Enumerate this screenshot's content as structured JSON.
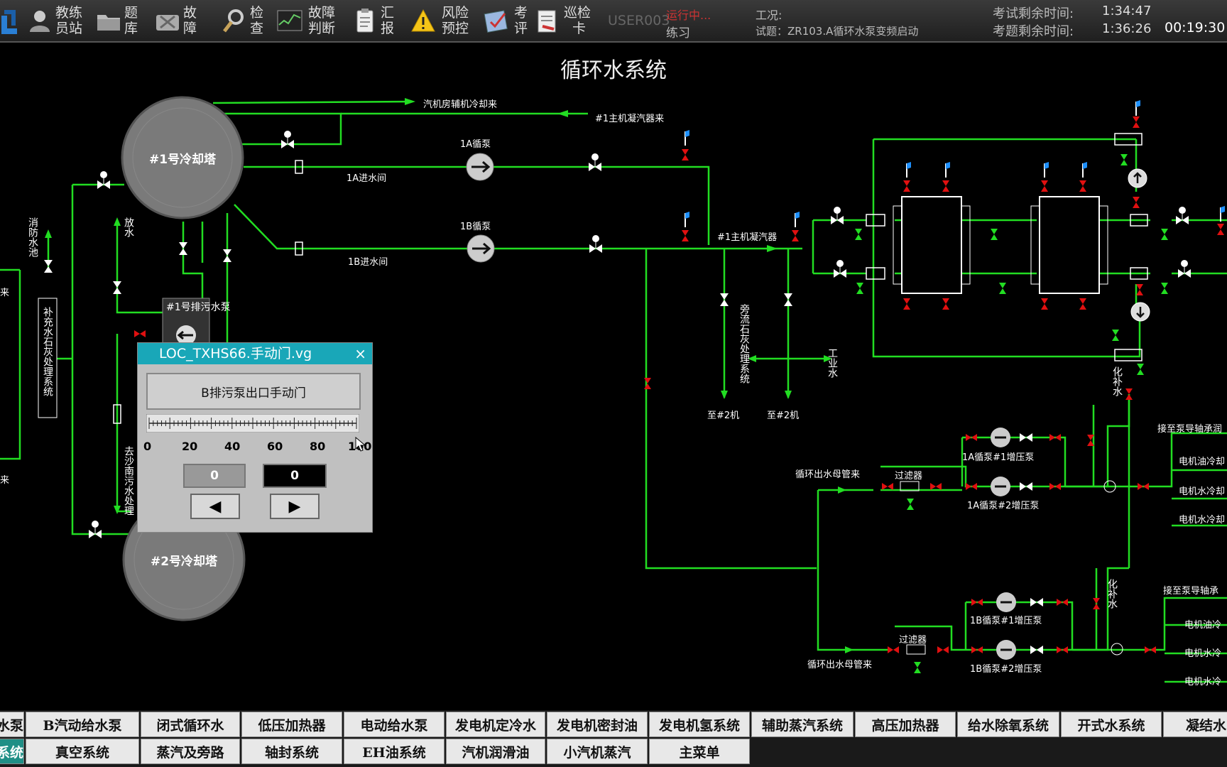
{
  "toolbar": {
    "items": [
      {
        "label_top": "教练",
        "label_bottom": "员站",
        "icon": "user-icon"
      },
      {
        "label_top": "题",
        "label_bottom": "库",
        "icon": "folder-icon"
      },
      {
        "label_top": "故",
        "label_bottom": "障",
        "icon": "tools-icon"
      },
      {
        "label_top": "检",
        "label_bottom": "查",
        "icon": "magnifier-icon"
      },
      {
        "label_top": "故障",
        "label_bottom": "判断",
        "icon": "trend-icon"
      },
      {
        "label_top": "汇",
        "label_bottom": "报",
        "icon": "clipboard-icon"
      },
      {
        "label_top": "风险",
        "label_bottom": "预控",
        "icon": "warning-icon"
      },
      {
        "label_top": "考",
        "label_bottom": "评",
        "icon": "evaluate-icon"
      },
      {
        "label_top": "巡检",
        "label_bottom": "卡",
        "icon": "inspection-card-icon"
      }
    ],
    "user": "USER003",
    "running": "运行中...",
    "mode": "练习",
    "condition_label": "工况:",
    "exam_question": "试题：ZR103.A循环水泵变频启动",
    "exam_remaining_label": "考试剩余时间:",
    "exam_remaining": "1:34:47",
    "question_remaining_label": "考题剩余时间:",
    "question_remaining": "1:36:26",
    "clock": "00:19:30"
  },
  "title": "循环水系统",
  "diagram": {
    "tower1": "#1号冷却塔",
    "tower2": "#2号冷却塔",
    "from_aux_cooling": "汽机房辅机冷却来",
    "from_main_condenser": "#1主机凝汽器来",
    "pump_1a": "1A循泵",
    "pump_1b": "1B循泵",
    "inlet_1a": "1A进水间",
    "inlet_1b": "1B进水间",
    "condenser": "#1主机凝汽器",
    "to_unit2_a": "至#2机",
    "to_unit2_b": "至#2机",
    "bypass_lime": "旁流石灰处理系统",
    "industrial_water": "工业水",
    "fire_pool": "消防水池",
    "makeup_lime": "补充水石灰处理系统",
    "drain": "放水",
    "drain_pump": "#1号排污水泵",
    "to_shanan": "去沙南污水处理",
    "left_cut_1": "来",
    "left_cut_2": "来",
    "circ_outlet_1": "循环出水母管来",
    "circ_outlet_2": "循环出水母管来",
    "filter_1": "过滤器",
    "filter_2": "过滤器",
    "booster_1a1": "1A循泵#1增压泵",
    "booster_1a2": "1A循泵#2增压泵",
    "booster_1b1": "1B循泵#1增压泵",
    "booster_1b2": "1B循泵#2增压泵",
    "chem_makeup_1": "化补水",
    "chem_makeup_2": "化补水",
    "to_bearing_1": "接至泵导轴承润",
    "to_bearing_2": "接至泵导轴承",
    "motor_oil_1": "电机油冷却",
    "motor_water_1": "电机水冷却",
    "motor_water_2": "电机水冷却",
    "motor_oil_2": "电机油冷",
    "motor_water_3": "电机水冷",
    "motor_water_4": "电机水冷"
  },
  "dialog": {
    "title": "LOC_TXHS66.手动门.vg",
    "close": "×",
    "name": "B排污泵出口手动门",
    "scale": [
      "0",
      "20",
      "40",
      "60",
      "80",
      "100"
    ],
    "value_set": "0",
    "value_actual": "0",
    "left_button": "◀",
    "right_button": "▶"
  },
  "bottom_nav": {
    "row1": [
      "水泵",
      "B汽动给水泵",
      "闭式循环水",
      "低压加热器",
      "电动给水泵",
      "发电机定冷水",
      "发电机密封油",
      "发电机氢系统",
      "辅助蒸汽系统",
      "高压加热器",
      "给水除氧系统",
      "开式水系统",
      "凝结水系"
    ],
    "row2": [
      "系统",
      "真空系统",
      "蒸汽及旁路",
      "轴封系统",
      "EH油系统",
      "汽机润滑油",
      "小汽机蒸汽",
      "主菜单"
    ]
  }
}
